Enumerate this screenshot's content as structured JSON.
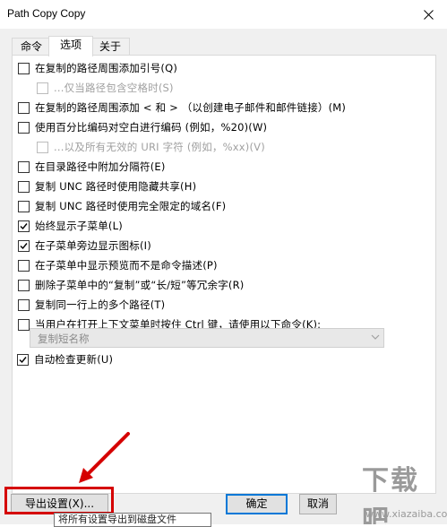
{
  "window": {
    "title": "Path Copy Copy"
  },
  "tabs": [
    {
      "label": "命令",
      "active": false
    },
    {
      "label": "选项",
      "active": true
    },
    {
      "label": "关于",
      "active": false
    }
  ],
  "options": [
    {
      "label": "在复制的路径周围添加引号(Q)",
      "checked": false,
      "disabled": false,
      "indent": false
    },
    {
      "label": "...仅当路径包含空格时(S)",
      "checked": false,
      "disabled": true,
      "indent": true
    },
    {
      "label": "在复制的路径周围添加 < 和 > （以创建电子邮件和邮件链接）(M)",
      "checked": false,
      "disabled": false,
      "indent": false
    },
    {
      "label": "使用百分比编码对空白进行编码 (例如，%20)(W)",
      "checked": false,
      "disabled": false,
      "indent": false
    },
    {
      "label": "...以及所有无效的 URI 字符 (例如，%xx)(V)",
      "checked": false,
      "disabled": true,
      "indent": true
    },
    {
      "label": "在目录路径中附加分隔符(E)",
      "checked": false,
      "disabled": false,
      "indent": false
    },
    {
      "label": "复制 UNC 路径时使用隐藏共享(H)",
      "checked": false,
      "disabled": false,
      "indent": false
    },
    {
      "label": "复制 UNC 路径时使用完全限定的域名(F)",
      "checked": false,
      "disabled": false,
      "indent": false
    },
    {
      "label": "始终显示子菜单(L)",
      "checked": true,
      "disabled": false,
      "indent": false
    },
    {
      "label": "在子菜单旁边显示图标(I)",
      "checked": true,
      "disabled": false,
      "indent": false
    },
    {
      "label": "在子菜单中显示预览而不是命令描述(P)",
      "checked": false,
      "disabled": false,
      "indent": false
    },
    {
      "label": "删除子菜单中的“复制”或“长/短”等冗余字(R)",
      "checked": false,
      "disabled": false,
      "indent": false
    },
    {
      "label": "复制同一行上的多个路径(T)",
      "checked": false,
      "disabled": false,
      "indent": false
    },
    {
      "label": "当用户在打开上下文菜单时按住 Ctrl 键，请使用以下命令(K):",
      "checked": false,
      "disabled": false,
      "indent": false
    }
  ],
  "combo": {
    "value": "复制短名称"
  },
  "auto_update": {
    "label": "自动检查更新(U)",
    "checked": true
  },
  "buttons": {
    "export": "导出设置(X)...",
    "ok": "确定",
    "cancel": "取消"
  },
  "tooltip": {
    "text": "将所有设置导出到磁盘文件"
  },
  "watermark": {
    "text": "下载吧",
    "url": "www.xiazaiba.com"
  },
  "colors": {
    "accent": "#0078d7",
    "highlight_red": "#d50000"
  }
}
